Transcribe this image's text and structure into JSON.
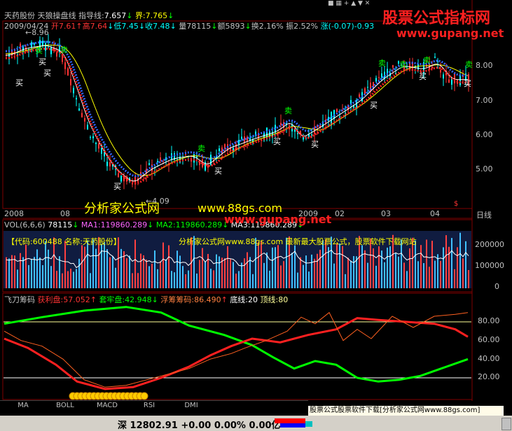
{
  "header": {
    "stock_name": "天药股份",
    "indicator_name": "天狼操盘线",
    "guide_label": "指导线:",
    "guide_value": "7.657",
    "bound_label": "界:",
    "bound_value": "7.765",
    "date": "2009/04/24",
    "open_label": "开",
    "open": "7.61",
    "high_label": "高",
    "high": "7.64",
    "low_label": "低",
    "low": "7.45",
    "close_label": "收",
    "close": "7.48",
    "vol_label": "量",
    "vol": "78115",
    "amount_label": "额",
    "amount": "5893",
    "turnover_label": "换",
    "turnover": "2.16%",
    "amplitude_label": "振",
    "amplitude": "2.52%",
    "change_label": "涨",
    "change": "(-0.07)-0.93"
  },
  "price_panel": {
    "high_marker": "8.96",
    "low_marker": "4.09",
    "price_ticks": [
      "8.00",
      "7.00",
      "6.00",
      "5.00"
    ],
    "time_labels": [
      "2008",
      "08",
      "2009",
      "02",
      "03",
      "04"
    ],
    "period_label": "日线",
    "buy_label": "买",
    "sell_label": "卖"
  },
  "volume_panel": {
    "title": "VOL(6,6,6)",
    "vol_value": "78115",
    "ma1_label": "MA1:",
    "ma1": "119860.289",
    "ma2_label": "MA2:",
    "ma2": "119860.289",
    "ma3_label": "MA3:",
    "ma3": "119860.289",
    "info_text": "【代码:600488 名称:天药股份】",
    "ad_text": "分析家公式网www.88gs.com 最新最大股票公式，股票软件下载网站",
    "ticks": [
      "200000",
      "100000",
      "0"
    ]
  },
  "indicator_panel": {
    "title": "飞刀筹码",
    "profit_label": "获利盘:",
    "profit": "57.052",
    "trap_label": "套牢盘:",
    "trap": "42.948",
    "float_label": "浮筹筹码:",
    "float": "86.490",
    "bottom_label": "底线:",
    "bottom": "20",
    "top_label": "顶线:",
    "top": "80",
    "ticks": [
      "80.00",
      "60.00",
      "40.00",
      "20.00"
    ]
  },
  "tabs": [
    "MA",
    "BOLL",
    "MACD",
    "RSI",
    "DMI"
  ],
  "status_bar": {
    "market": "深",
    "index": "12802.91",
    "change": "+0.00",
    "pct": "0.00%",
    "amount": "0.00亿",
    "banner": "股票公式股票软件下载[分析家公式网www.88gs.com]"
  },
  "watermarks": {
    "logo_title": "股票公式指标网",
    "logo_url": "www.gupang.net",
    "wm_cn": "分析家公式网",
    "wm_url1": "www.88gs.com",
    "wm_url2": "www.gupang.net"
  },
  "colors": {
    "up": "#ff3333",
    "down": "#00ffff",
    "yellow": "#ffff00",
    "green": "#00ff00",
    "blue": "#3366ff"
  }
}
